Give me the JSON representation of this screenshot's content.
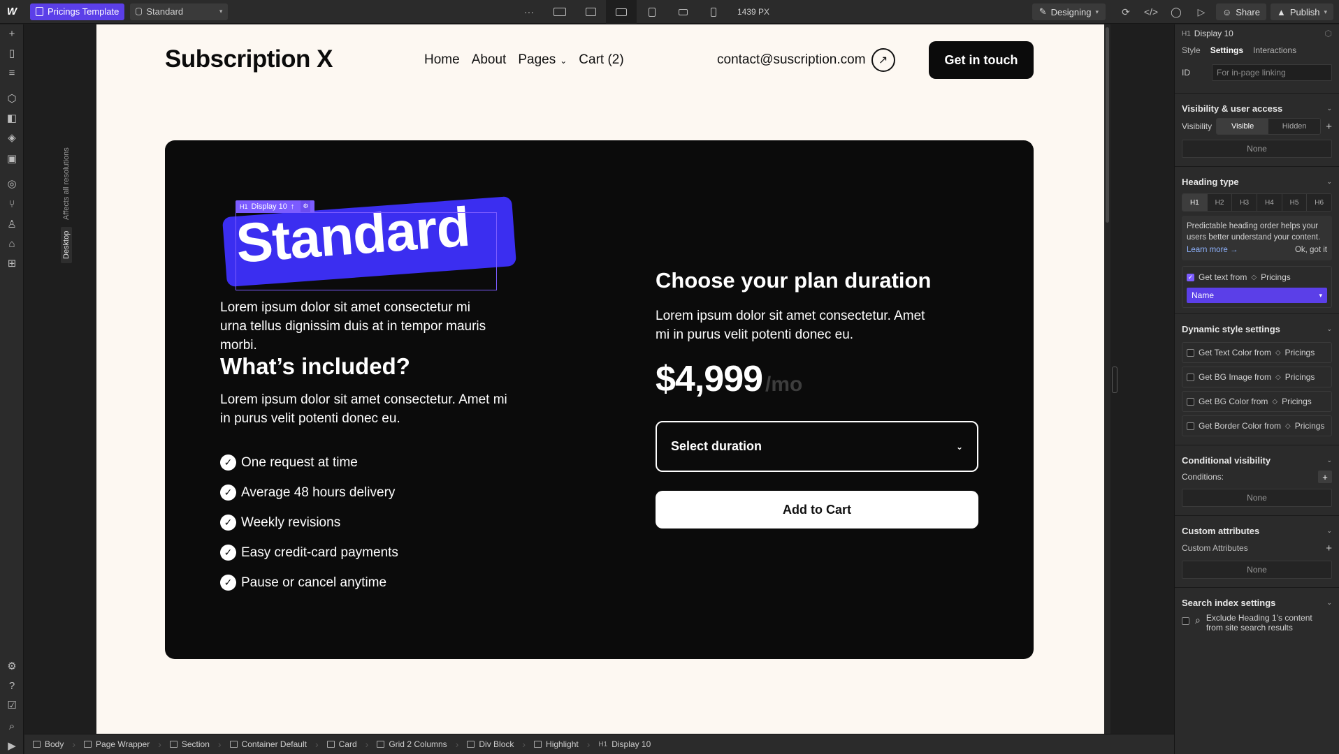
{
  "topbar": {
    "logo": "W",
    "page_name": "Pricings Template",
    "item_name": "Standard",
    "more": "···",
    "viewport_px": "1439 PX",
    "mode": "Designing",
    "share": "Share",
    "publish": "Publish"
  },
  "canvas": {
    "affects_label": "Affects all resolutions",
    "breakpoint_label": "Desktop"
  },
  "site": {
    "brand": "Subscription X",
    "nav": [
      "Home",
      "About",
      "Pages",
      "Cart (2)"
    ],
    "contact_email": "contact@suscription.com",
    "cta": "Get in touch"
  },
  "card": {
    "selection_tag": "Display 10",
    "selection_tag_prefix": "H1",
    "plan_name": "Standard",
    "lead": "Lorem ipsum dolor sit amet consectetur mi urna tellus dignissim duis at in tempor mauris morbi.",
    "included_title": "What’s included?",
    "included_desc": "Lorem ipsum dolor sit amet consectetur. Amet mi in purus velit potenti donec eu.",
    "features": [
      "One request at time",
      "Average 48 hours delivery",
      "Weekly revisions",
      "Easy credit-card payments",
      "Pause or cancel anytime"
    ],
    "duration_title": "Choose your plan duration",
    "duration_desc": "Lorem ipsum dolor sit amet consectetur. Amet mi in purus velit potenti donec eu.",
    "price": "$4,999",
    "price_period": "/mo",
    "select_placeholder": "Select duration",
    "add_to_cart": "Add to Cart"
  },
  "breadcrumbs": [
    "Body",
    "Page Wrapper",
    "Section",
    "Container Default",
    "Card",
    "Grid 2 Columns",
    "Div Block",
    "Highlight",
    "Display 10"
  ],
  "breadcrumb_last_prefix": "H1",
  "panel": {
    "element_prefix": "H1",
    "element": "Display 10",
    "tabs": [
      "Style",
      "Settings",
      "Interactions"
    ],
    "id_label": "ID",
    "id_placeholder": "For in-page linking",
    "visibility_section": "Visibility & user access",
    "visibility_label": "Visibility",
    "visible": "Visible",
    "hidden": "Hidden",
    "none": "None",
    "heading_section": "Heading type",
    "heading_levels": [
      "H1",
      "H2",
      "H3",
      "H4",
      "H5",
      "H6"
    ],
    "tip": "Predictable heading order helps your users better understand your content.",
    "learn_more": "Learn more →",
    "ok_got_it": "Ok, got it",
    "get_text_from": "Get text from",
    "collection": "Pricings",
    "field_value": "Name",
    "dynamic_section": "Dynamic style settings",
    "dynamic_items": [
      "Get Text Color from",
      "Get BG Image from",
      "Get BG Color from",
      "Get Border Color from"
    ],
    "conditional_section": "Conditional visibility",
    "conditions_label": "Conditions:",
    "custom_attr_section": "Custom attributes",
    "custom_attr_label": "Custom Attributes",
    "search_section": "Search index settings",
    "search_exclude": "Exclude Heading 1’s content from site search results"
  },
  "colors": {
    "accent": "#5b3fe8",
    "highlight": "#3b2ef0",
    "card_bg": "#0b0b0b",
    "page_bg": "#fdf8f2"
  }
}
